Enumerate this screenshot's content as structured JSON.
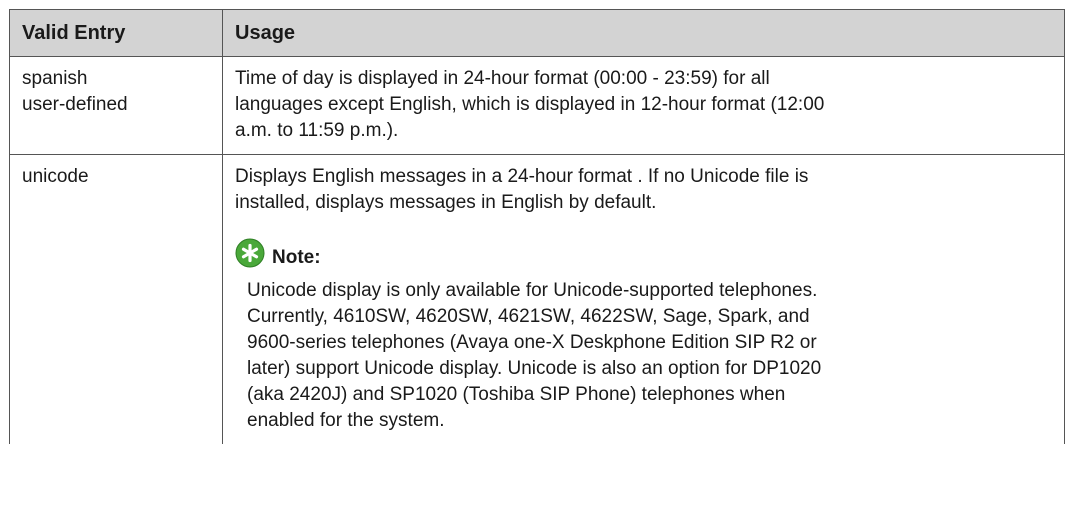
{
  "table": {
    "headers": [
      "Valid Entry",
      "Usage"
    ],
    "rows": [
      {
        "entry_lines": [
          "spanish",
          "user-defined"
        ],
        "usage_lines": [
          "Time of day is displayed in 24-hour format (00:00 - 23:59) for all",
          "languages except English, which is displayed in 12-hour format (12:00",
          "a.m. to 11:59 p.m.)."
        ]
      },
      {
        "entry_lines": [
          "unicode"
        ],
        "usage_lines": [
          "Displays English messages in a 24-hour format . If no Unicode file is",
          "installed, displays messages in English by default."
        ],
        "note": {
          "label": "Note:",
          "icon": "note-star-icon",
          "lines": [
            "Unicode display is only available for Unicode-supported telephones.",
            "Currently, 4610SW, 4620SW, 4621SW, 4622SW, Sage, Spark, and",
            "9600-series telephones (Avaya one-X Deskphone Edition SIP R2 or",
            "later) support Unicode display. Unicode is also an option for DP1020",
            "(aka 2420J) and SP1020 (Toshiba SIP Phone) telephones when",
            "enabled for the system."
          ]
        }
      }
    ]
  },
  "colors": {
    "header_bg": "#d3d3d3",
    "border": "#555555",
    "note_icon_fill": "#4aa83a",
    "text": "#1a1a1a"
  }
}
